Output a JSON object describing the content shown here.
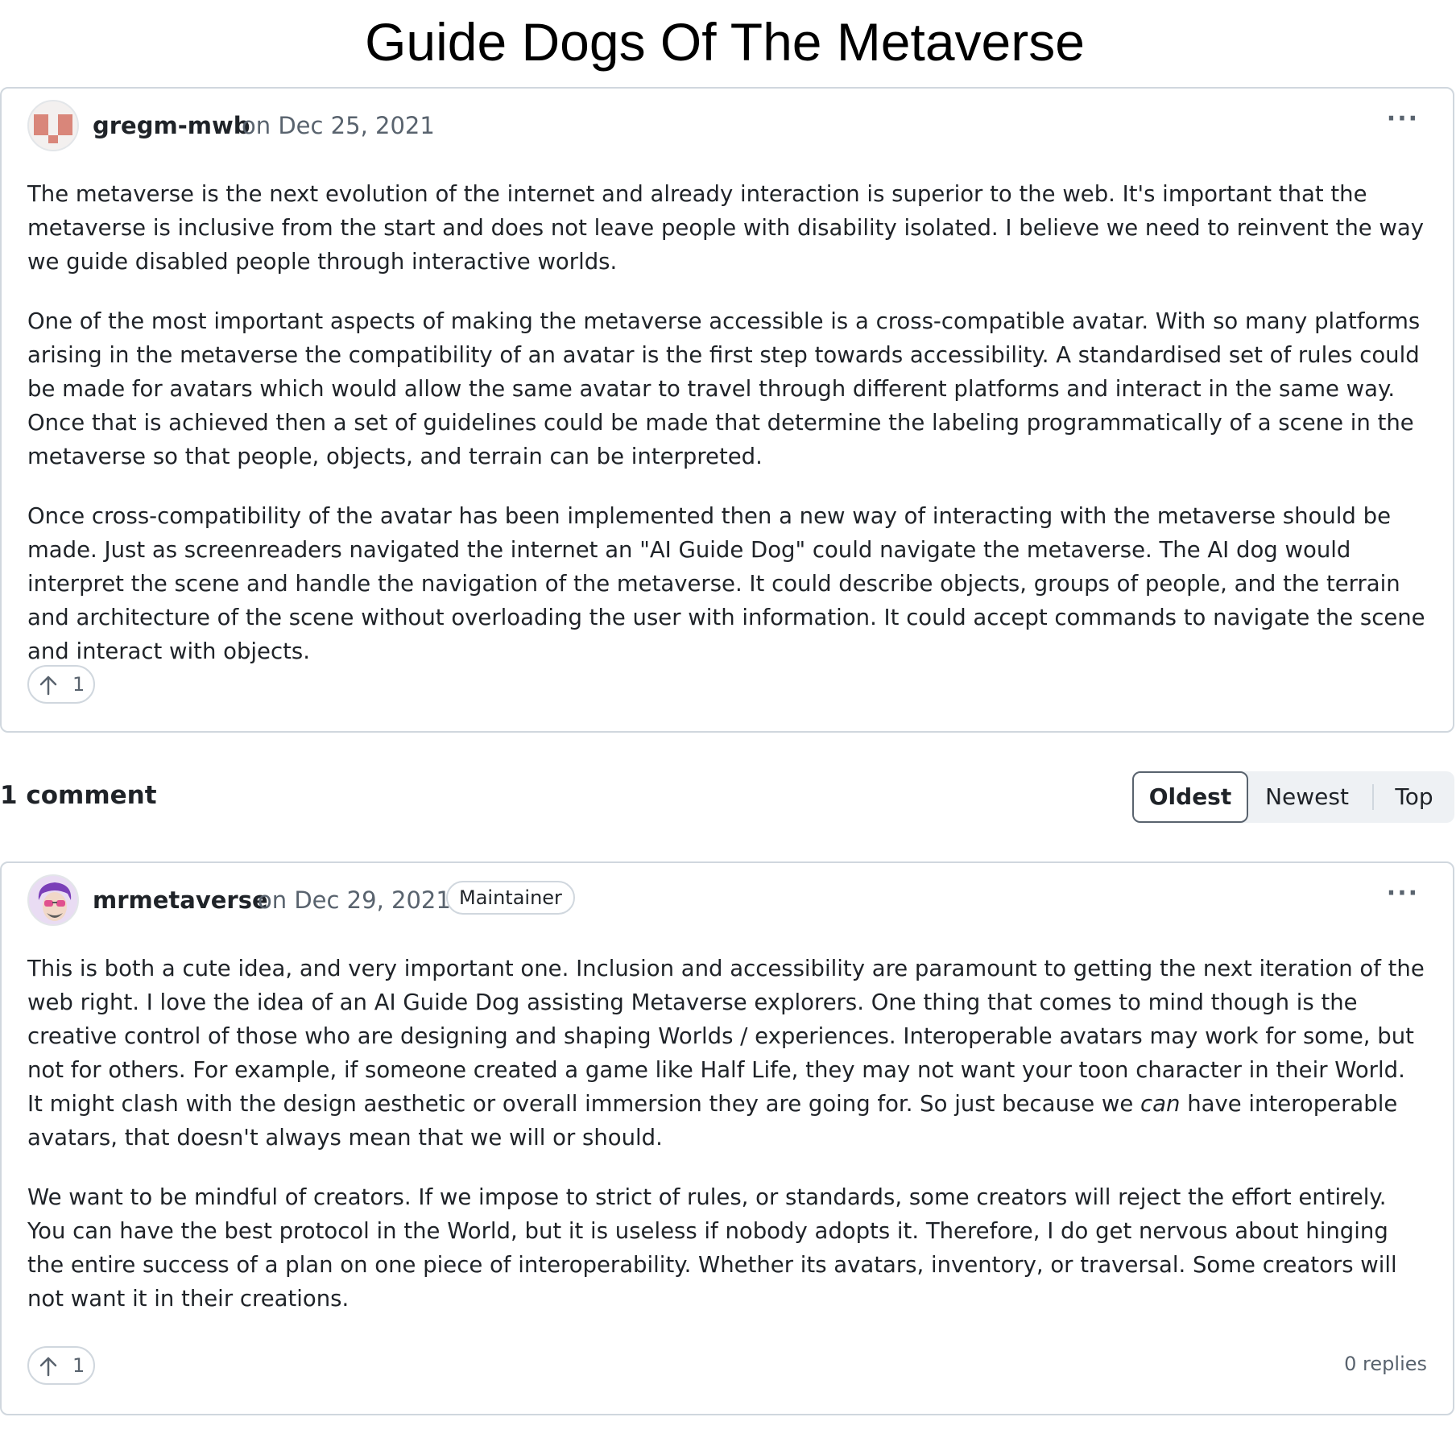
{
  "page": {
    "title": "Guide Dogs Of The Metaverse"
  },
  "post": {
    "author": "gregm-mwb",
    "date": "on Dec 25, 2021",
    "more_label": "···",
    "paragraphs": [
      "The metaverse is the next evolution of the internet and already interaction is superior to the web. It's important that the metaverse is inclusive from the start and does not leave people with disability isolated. I believe we need to reinvent the way we guide disabled people through interactive worlds.",
      "One of the most important aspects of making the metaverse accessible is a cross-compatible avatar. With so many platforms arising in the metaverse the compatibility of an avatar is the first step towards accessibility. A standardised set of rules could be made for avatars which would allow the same avatar to travel through different platforms and interact in the same way. Once that is achieved then a set of guidelines could be made that determine the labeling programmatically of a scene in the metaverse so that people, objects, and terrain can be interpreted.",
      "Once cross-compatibility of the avatar has been implemented then a new way of interacting with the metaverse should be made. Just as screenreaders navigated the internet an \"AI Guide Dog\" could navigate the metaverse. The AI dog would interpret the scene and handle the navigation of the metaverse. It could describe objects, groups of people, and the terrain and architecture of the scene without overloading the user with information. It could accept commands to navigate the scene and interact with objects."
    ],
    "upvotes": "1",
    "upvote_icon": "arrow-up-icon"
  },
  "comments_header": {
    "count_label": "1 comment",
    "sort_options": [
      "Oldest",
      "Newest",
      "Top"
    ],
    "selected_sort": "Oldest"
  },
  "comment": {
    "author": "mrmetaverse",
    "date": "on Dec 29, 2021",
    "badge": "Maintainer",
    "more_label": "···",
    "p1_before": "This is both a cute idea, and very important one. Inclusion and accessibility are paramount to getting the next iteration of the web right. I love the idea of an AI Guide Dog assisting Metaverse explorers. One thing that comes to mind though is the creative control of those who are designing and shaping Worlds / experiences. Interoperable avatars may work for some, but not for others. For example, if someone created a game like Half Life, they may not want your toon character in their World. It might clash with the design aesthetic or overall immersion they are going for. So just because we ",
    "p1_em": "can",
    "p1_after": " have interoperable avatars, that doesn't always mean that we will or should.",
    "p2": "We want to be mindful of creators. If we impose to strict of rules, or standards, some creators will reject the effort entirely. You can have the best protocol in the World, but it is useless if nobody adopts it. Therefore, I do get nervous about hinging the entire success of a plan on one piece of interoperability. Whether its avatars, inventory, or traversal. Some creators will not want it in their creations.",
    "upvotes": "1",
    "replies": "0 replies"
  },
  "colors": {
    "border": "#d0d7de",
    "muted_text": "#59636e",
    "text": "#1f2328",
    "sort_bg": "#eef1f4"
  }
}
